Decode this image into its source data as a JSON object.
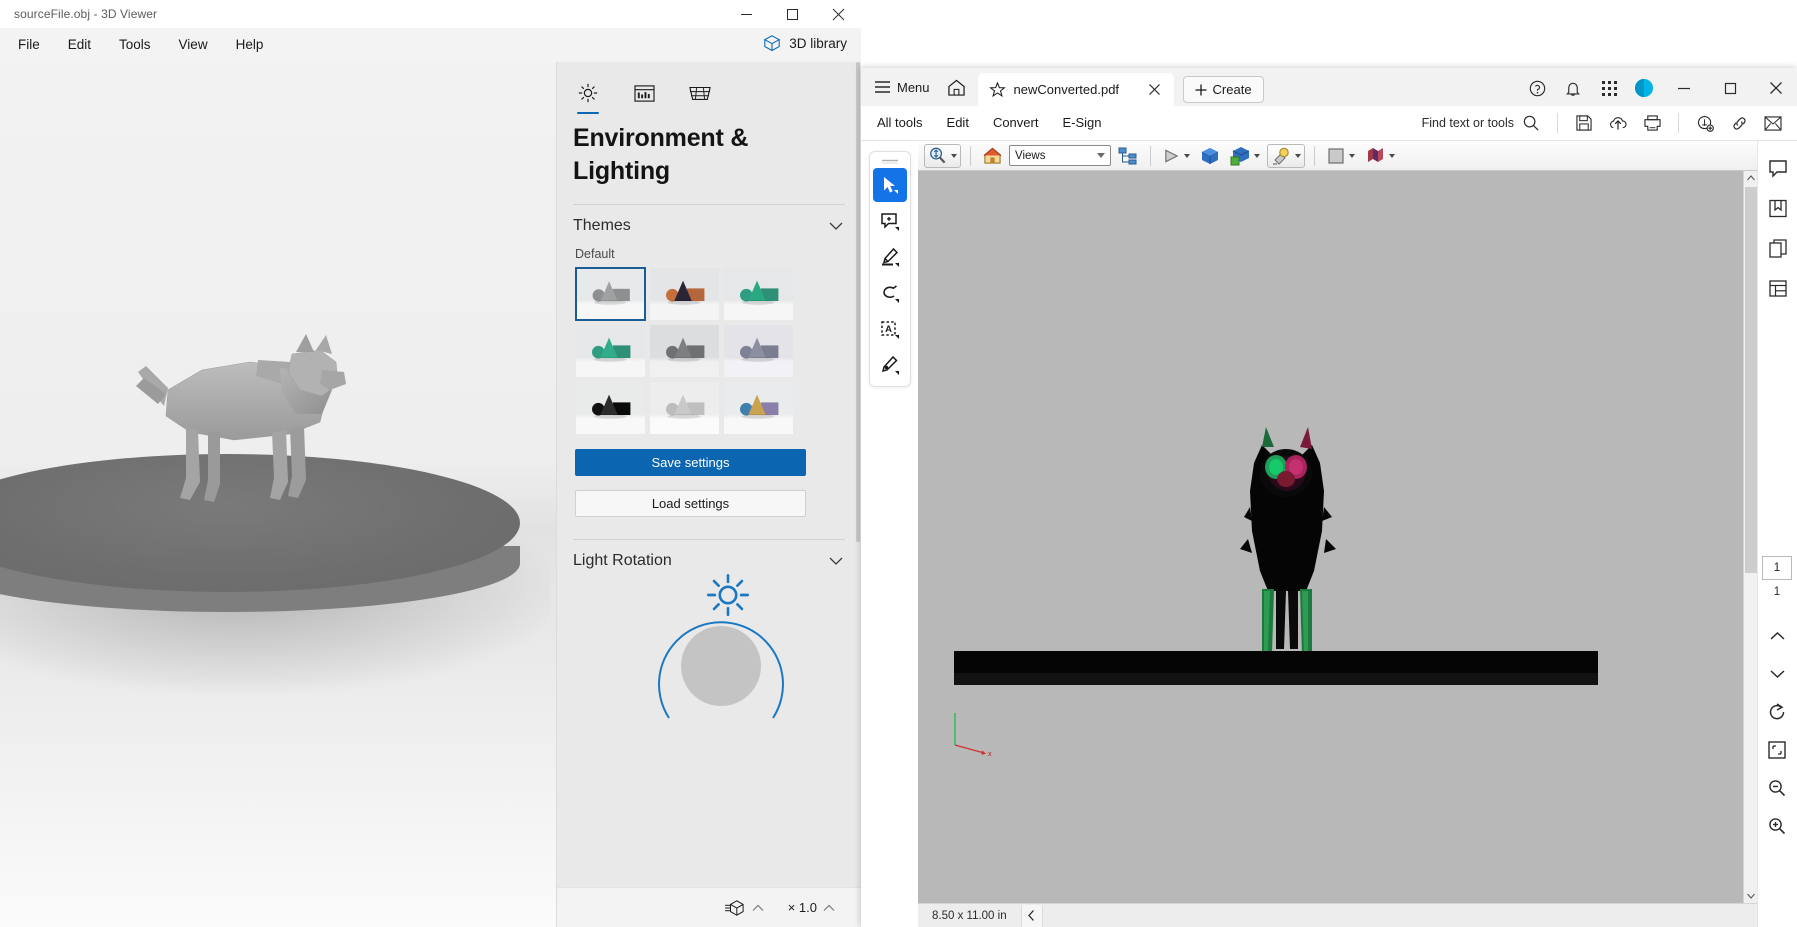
{
  "viewer3d": {
    "title": "sourceFile.obj - 3D Viewer",
    "window_controls": {
      "minimize": "minimize-icon",
      "maximize": "maximize-icon",
      "close": "close-icon"
    },
    "menu": [
      "File",
      "Edit",
      "Tools",
      "View",
      "Help"
    ],
    "library_label": "3D library",
    "panel": {
      "tabs": [
        {
          "name": "lighting-tab",
          "icon": "sun-icon",
          "active": true
        },
        {
          "name": "materials-tab",
          "icon": "image-icon",
          "active": false
        },
        {
          "name": "grid-tab",
          "icon": "grid-icon",
          "active": false
        }
      ],
      "heading": "Environment & Lighting",
      "themes": {
        "section_title": "Themes",
        "group_label": "Default",
        "selected_index": 0,
        "items": [
          {
            "name": "theme-default-light",
            "bg_top": "#e8e9ea",
            "bg_bottom": "#f7f7f8",
            "sphere": "#8d8f90",
            "cone": "#9fa1a2",
            "cube": "#8d8f90"
          },
          {
            "name": "theme-sunset",
            "bg_top": "#e4e5e6",
            "bg_bottom": "#f4f4f5",
            "sphere": "#c2703c",
            "cone": "#2a2435",
            "cube": "#b5663a"
          },
          {
            "name": "theme-teal",
            "bg_top": "#e6e7e8",
            "bg_bottom": "#f6f6f7",
            "sphere": "#2f9d82",
            "cone": "#2aa882",
            "cube": "#2f8f77"
          },
          {
            "name": "theme-green",
            "bg_top": "#e6e7e8",
            "bg_bottom": "#f6f6f7",
            "sphere": "#2f9d82",
            "cone": "#31ad8a",
            "cube": "#2f8f77"
          },
          {
            "name": "theme-grey",
            "bg_top": "#dcdddf",
            "bg_bottom": "#f0f0f1",
            "sphere": "#6f7173",
            "cone": "#7d7f81",
            "cube": "#6e7072"
          },
          {
            "name": "theme-lavender",
            "bg_top": "#e3e3e8",
            "bg_bottom": "#f2f2f6",
            "sphere": "#7f8195",
            "cone": "#8c8ea2",
            "cube": "#7b7d91"
          },
          {
            "name": "theme-dark",
            "bg_top": "#e9eaea",
            "bg_bottom": "#f8f8f8",
            "sphere": "#111111",
            "cone": "#2c2c2c",
            "cube": "#0a0a0a"
          },
          {
            "name": "theme-white",
            "bg_top": "#ededee",
            "bg_bottom": "#fbfbfb",
            "sphere": "#bdbdbd",
            "cone": "#c9c9c9",
            "cube": "#bfbfbf"
          },
          {
            "name": "theme-colorful",
            "bg_top": "#eaebec",
            "bg_bottom": "#f8f8f9",
            "sphere": "#3f7fae",
            "cone": "#caa34f",
            "cube": "#8a7fa8"
          }
        ]
      },
      "buttons": {
        "save": "Save settings",
        "load": "Load settings"
      },
      "light_rotation": {
        "section_title": "Light Rotation",
        "icon": "sun-icon"
      }
    },
    "statusbar": {
      "model_icon": "3d-model-icon",
      "zoom_label": "× 1.0"
    }
  },
  "acrobat": {
    "tabbar": {
      "menu_label": "Menu",
      "home_icon": "home-icon",
      "tab": {
        "label": "newConverted.pdf",
        "star_icon": "star-icon",
        "close_icon": "close-icon"
      },
      "create_label": "Create",
      "right_icons": [
        "help-icon",
        "bell-icon",
        "apps-grid-icon"
      ],
      "avatar": "avatar",
      "window_controls": {
        "minimize": "minimize-icon",
        "maximize": "maximize-icon",
        "close": "close-icon"
      }
    },
    "toolrow": {
      "tools": [
        "All tools",
        "Edit",
        "Convert",
        "E-Sign"
      ],
      "find_label": "Find text or tools",
      "find_icon": "search-icon",
      "right_icons": [
        "save-icon",
        "upload-cloud-icon",
        "print-icon",
        "add-stamp-icon",
        "link-icon",
        "mail-icon"
      ]
    },
    "lefttools": [
      {
        "name": "select-tool",
        "icon": "cursor-icon",
        "active": true
      },
      {
        "name": "comment-tool",
        "icon": "comment-plus-icon",
        "active": false
      },
      {
        "name": "highlight-tool",
        "icon": "highlighter-icon",
        "active": false
      },
      {
        "name": "draw-tool",
        "icon": "lasso-icon",
        "active": false
      },
      {
        "name": "text-edit-tool",
        "icon": "select-text-icon",
        "active": false
      },
      {
        "name": "sign-tool",
        "icon": "sign-icon",
        "active": false
      }
    ],
    "toolbar3d": {
      "zoom_icon": "zoom-3d-icon",
      "home_icon": "home-view-icon",
      "views_value": "Views",
      "tree_icon": "model-tree-icon",
      "play_icon": "play-icon",
      "cube_icon": "cube-icon",
      "parts_icon": "parts-cube-icon",
      "light_icon": "light-icon",
      "background_icon": "background-color-icon",
      "render_icon": "render-mode-icon"
    },
    "page": {
      "size_label": "8.50 x 11.00 in",
      "collapse_icon": "chevron-left-icon"
    },
    "rightbar": {
      "icons": [
        "comment-panel-icon",
        "bookmark-icon",
        "pages-panel-icon",
        "layers-panel-icon"
      ],
      "page_current": "1",
      "page_total": "1",
      "nav_icons": [
        "chevron-up-icon",
        "chevron-down-icon",
        "rotate-icon",
        "fit-page-icon",
        "zoom-out-icon",
        "zoom-in-icon"
      ]
    }
  }
}
